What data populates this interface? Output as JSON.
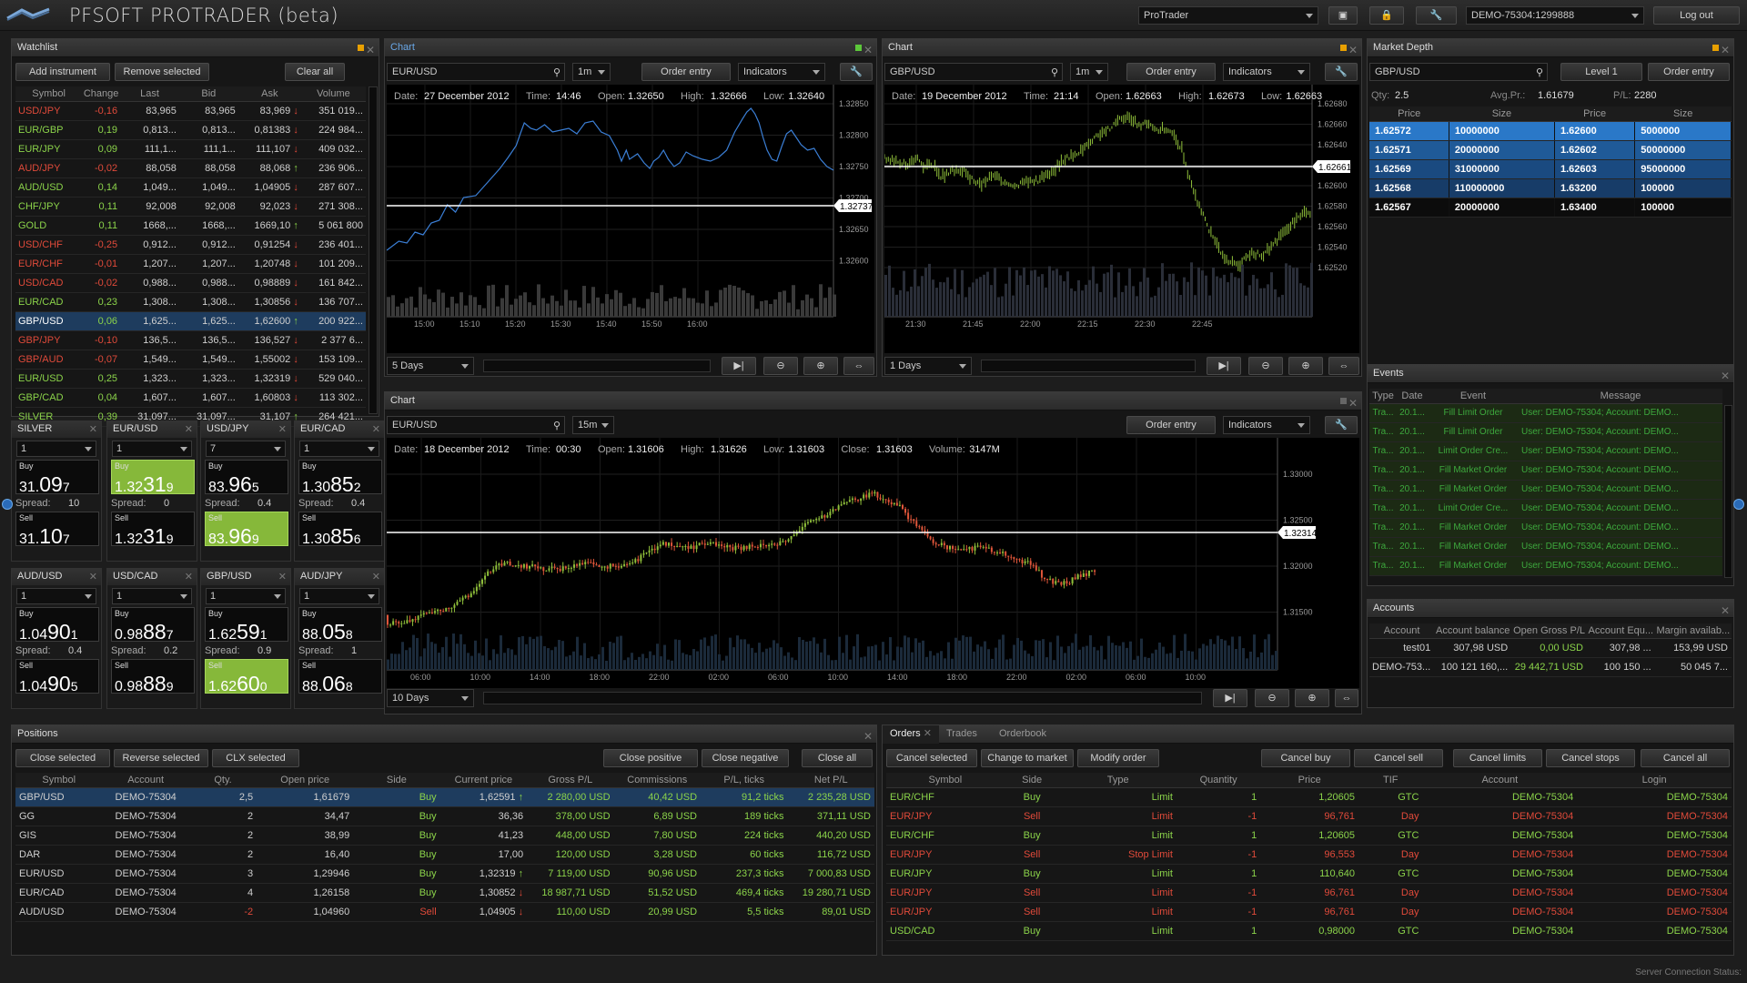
{
  "app": {
    "title": "PFSOFT PROTRADER (beta)",
    "workspace": "ProTrader",
    "account": "DEMO-75304:1299888",
    "logout": "Log out",
    "status": "Server Connection Status:"
  },
  "watchlist": {
    "title": "Watchlist",
    "add": "Add instrument",
    "remove": "Remove selected",
    "clear": "Clear all",
    "cols": [
      "Symbol",
      "Change",
      "Last",
      "Bid",
      "Ask",
      "Volume"
    ],
    "rows": [
      [
        "USD/JPY",
        "-0,16",
        "83,965",
        "83,965",
        "83,969",
        "351 019...",
        "red",
        "dn"
      ],
      [
        "EUR/GBP",
        "0,19",
        "0,813...",
        "0,813...",
        "0,81383",
        "224 984...",
        "grn",
        "dn"
      ],
      [
        "EUR/JPY",
        "0,09",
        "111,1...",
        "111,1...",
        "111,107",
        "409 032...",
        "grn",
        "dn"
      ],
      [
        "AUD/JPY",
        "-0,02",
        "88,058",
        "88,058",
        "88,068",
        "236 906...",
        "red",
        "up"
      ],
      [
        "AUD/USD",
        "0,14",
        "1,049...",
        "1,049...",
        "1,04905",
        "287 607...",
        "grn",
        "dn"
      ],
      [
        "CHF/JPY",
        "0,11",
        "92,008",
        "92,008",
        "92,023",
        "271 308...",
        "grn",
        "dn"
      ],
      [
        "GOLD",
        "0,11",
        "1668,...",
        "1668,...",
        "1669,10",
        "5 061 800",
        "grn",
        "up"
      ],
      [
        "USD/CHF",
        "-0,25",
        "0,912...",
        "0,912...",
        "0,91254",
        "236 401...",
        "red",
        "dn"
      ],
      [
        "EUR/CHF",
        "-0,01",
        "1,207...",
        "1,207...",
        "1,20748",
        "101 209...",
        "red",
        "dn"
      ],
      [
        "USD/CAD",
        "-0,02",
        "0,988...",
        "0,988...",
        "0,98889",
        "161 842...",
        "red",
        "dn"
      ],
      [
        "EUR/CAD",
        "0,23",
        "1,308...",
        "1,308...",
        "1,30856",
        "136 707...",
        "grn",
        "dn"
      ],
      [
        "GBP/USD",
        "0,06",
        "1,625...",
        "1,625...",
        "1,62600",
        "200 922...",
        "grn",
        "up"
      ],
      [
        "GBP/JPY",
        "-0,10",
        "136,5...",
        "136,5...",
        "136,527",
        "2 377 6...",
        "red",
        "dn"
      ],
      [
        "GBP/AUD",
        "-0,07",
        "1,549...",
        "1,549...",
        "1,55002",
        "153 109...",
        "red",
        "dn"
      ],
      [
        "EUR/USD",
        "0,25",
        "1,323...",
        "1,323...",
        "1,32319",
        "529 040...",
        "grn",
        "dn"
      ],
      [
        "GBP/CAD",
        "0,04",
        "1,607...",
        "1,607...",
        "1,60803",
        "113 302...",
        "grn",
        "dn"
      ],
      [
        "SILVER",
        "0,39",
        "31,097...",
        "31,097...",
        "31,107",
        "264 421...",
        "grn",
        "up"
      ]
    ]
  },
  "tiles": [
    {
      "sym": "SILVER",
      "qty": "1",
      "buy": [
        "31.",
        "09",
        "7"
      ],
      "spread": "10",
      "sell": [
        "31.",
        "10",
        "7"
      ],
      "hb": false,
      "hs": false
    },
    {
      "sym": "EUR/USD",
      "qty": "1",
      "buy": [
        "1.32",
        "31",
        "9"
      ],
      "spread": "0",
      "sell": [
        "1.32",
        "31",
        "9"
      ],
      "hb": true,
      "hs": false
    },
    {
      "sym": "USD/JPY",
      "qty": "7",
      "buy": [
        "83.",
        "96",
        "5"
      ],
      "spread": "0.4",
      "sell": [
        "83.",
        "96",
        "9"
      ],
      "hb": false,
      "hs": true
    },
    {
      "sym": "EUR/CAD",
      "qty": "1",
      "buy": [
        "1.30",
        "85",
        "2"
      ],
      "spread": "0.4",
      "sell": [
        "1.30",
        "85",
        "6"
      ],
      "hb": false,
      "hs": false
    },
    {
      "sym": "AUD/USD",
      "qty": "1",
      "buy": [
        "1.04",
        "90",
        "1"
      ],
      "spread": "0.4",
      "sell": [
        "1.04",
        "90",
        "5"
      ],
      "hb": false,
      "hs": false
    },
    {
      "sym": "USD/CAD",
      "qty": "1",
      "buy": [
        "0.98",
        "88",
        "7"
      ],
      "spread": "0.2",
      "sell": [
        "0.98",
        "88",
        "9"
      ],
      "hb": false,
      "hs": false
    },
    {
      "sym": "GBP/USD",
      "qty": "1",
      "buy": [
        "1.62",
        "59",
        "1"
      ],
      "spread": "0.9",
      "sell": [
        "1.62",
        "60",
        "0"
      ],
      "hb": false,
      "hs": true
    },
    {
      "sym": "AUD/JPY",
      "qty": "1",
      "buy": [
        "88.",
        "05",
        "8"
      ],
      "spread": "1",
      "sell": [
        "88.",
        "06",
        "8"
      ],
      "hb": false,
      "hs": false
    }
  ],
  "tileLabels": {
    "buy": "Buy",
    "sell": "Sell",
    "spread": "Spread:"
  },
  "chart1": {
    "title": "Chart",
    "symbol": "EUR/USD",
    "tf": "1m",
    "order": "Order entry",
    "ind": "Indicators",
    "range": "5 Days",
    "info": {
      "date": "27 December 2012",
      "time": "14:46",
      "open": "1.32650",
      "high": "1.32666",
      "low": "1.32640"
    },
    "yticks": [
      "1.32850",
      "1.32800",
      "1.32750",
      "1.32700",
      "1.32650",
      "1.32600"
    ],
    "xticks": [
      "15:00",
      "15:10",
      "15:20",
      "15:30",
      "15:40",
      "15:50",
      "16:00"
    ],
    "last": "1.32737"
  },
  "chart2": {
    "title": "Chart",
    "symbol": "GBP/USD",
    "tf": "1m",
    "order": "Order entry",
    "ind": "Indicators",
    "range": "1 Days",
    "info": {
      "date": "19 December 2012",
      "time": "21:14",
      "open": "1.62663",
      "high": "1.62673",
      "low": "1.62663"
    },
    "yticks": [
      "1.62680",
      "1.62660",
      "1.62640",
      "1.62620",
      "1.62600",
      "1.62580",
      "1.62560",
      "1.62540",
      "1.62520"
    ],
    "xticks": [
      "21:30",
      "21:45",
      "22:00",
      "22:15",
      "22:30",
      "22:45"
    ],
    "last": "1.62661"
  },
  "chart3": {
    "title": "Chart",
    "symbol": "EUR/USD",
    "tf": "15m",
    "order": "Order entry",
    "ind": "Indicators",
    "range": "10 Days",
    "info": {
      "date": "18 December 2012",
      "time": "00:30",
      "open": "1.31606",
      "high": "1.31626",
      "low": "1.31603",
      "close": "1.31603",
      "volume": "3147M"
    },
    "yticks": [
      "1.33000",
      "1.32500",
      "1.32000",
      "1.31500"
    ],
    "xticks": [
      "06:00",
      "10:00",
      "14:00",
      "18:00",
      "22:00",
      "02:00",
      "06:00",
      "10:00",
      "14:00",
      "18:00",
      "22:00",
      "02:00",
      "06:00",
      "10:00"
    ],
    "last": "1.32314"
  },
  "infoLabels": {
    "date": "Date:",
    "time": "Time:",
    "open": "Open:",
    "high": "High:",
    "low": "Low:",
    "close": "Close:",
    "volume": "Volume:"
  },
  "depth": {
    "title": "Market Depth",
    "symbol": "GBP/USD",
    "level": "Level 1",
    "order": "Order entry",
    "qtyL": "Qty:",
    "qty": "2.5",
    "avgL": "Avg.Pr.:",
    "avg": "1.61679",
    "plL": "P/L:",
    "pl": "2280",
    "cols": [
      "Price",
      "Size",
      "Price",
      "Size"
    ],
    "rows": [
      [
        "1.62572",
        "10000000",
        "1.62600",
        "5000000"
      ],
      [
        "1.62571",
        "20000000",
        "1.62602",
        "50000000"
      ],
      [
        "1.62569",
        "31000000",
        "1.62603",
        "95000000"
      ],
      [
        "1.62568",
        "110000000",
        "1.63200",
        "100000"
      ],
      [
        "1.62567",
        "20000000",
        "1.63400",
        "100000"
      ]
    ]
  },
  "events": {
    "title": "Events",
    "cols": [
      "Type",
      "Date",
      "Event",
      "Message"
    ],
    "rows": [
      [
        "Tra...",
        "20.1...",
        "Fill Limit Order",
        "User: DEMO-75304; Account: DEMO..."
      ],
      [
        "Tra...",
        "20.1...",
        "Fill Limit Order",
        "User: DEMO-75304; Account: DEMO..."
      ],
      [
        "Tra...",
        "20.1...",
        "Limit Order Cre...",
        "User: DEMO-75304; Account: DEMO..."
      ],
      [
        "Tra...",
        "20.1...",
        "Fill Market Order",
        "User: DEMO-75304; Account: DEMO..."
      ],
      [
        "Tra...",
        "20.1...",
        "Fill Market Order",
        "User: DEMO-75304; Account: DEMO..."
      ],
      [
        "Tra...",
        "20.1...",
        "Limit Order Cre...",
        "User: DEMO-75304; Account: DEMO..."
      ],
      [
        "Tra...",
        "20.1...",
        "Fill Market Order",
        "User: DEMO-75304; Account: DEMO..."
      ],
      [
        "Tra...",
        "20.1...",
        "Fill Market Order",
        "User: DEMO-75304; Account: DEMO..."
      ],
      [
        "Tra...",
        "20.1...",
        "Fill Market Order",
        "User: DEMO-75304; Account: DEMO..."
      ]
    ]
  },
  "accounts": {
    "title": "Accounts",
    "cols": [
      "Account",
      "Account balance",
      "Open Gross P/L",
      "Account Equ...",
      "Margin availab..."
    ],
    "rows": [
      [
        "test01",
        "307,98 USD",
        "0,00 USD",
        "307,98 ...",
        "153,99 USD"
      ],
      [
        "DEMO-753...",
        "100 121 160,...",
        "29 442,71 USD",
        "100 150 ...",
        "50 045 7..."
      ]
    ]
  },
  "positions": {
    "title": "Positions",
    "b1": "Close selected",
    "b2": "Reverse selected",
    "b3": "CLX selected",
    "b4": "Close positive",
    "b5": "Close negative",
    "b6": "Close all",
    "cols": [
      "Symbol",
      "Account",
      "Qty.",
      "Open price",
      "Side",
      "Current price",
      "Gross P/L",
      "Commissions",
      "P/L, ticks",
      "Net P/L"
    ],
    "rows": [
      [
        "GBP/USD",
        "DEMO-75304",
        "2,5",
        "1,61679",
        "Buy",
        "1,62591",
        "2 280,00 USD",
        "40,42 USD",
        "91,2 ticks",
        "2 235,28 USD",
        "up"
      ],
      [
        "GG",
        "DEMO-75304",
        "2",
        "34,47",
        "Buy",
        "36,36",
        "378,00 USD",
        "6,89 USD",
        "189 ticks",
        "371,11 USD",
        ""
      ],
      [
        "GIS",
        "DEMO-75304",
        "2",
        "38,99",
        "Buy",
        "41,23",
        "448,00 USD",
        "7,80 USD",
        "224 ticks",
        "440,20 USD",
        ""
      ],
      [
        "DAR",
        "DEMO-75304",
        "2",
        "16,40",
        "Buy",
        "17,00",
        "120,00 USD",
        "3,28 USD",
        "60 ticks",
        "116,72 USD",
        ""
      ],
      [
        "EUR/USD",
        "DEMO-75304",
        "3",
        "1,29946",
        "Buy",
        "1,32319",
        "7 119,00 USD",
        "90,96 USD",
        "237,3 ticks",
        "7 000,83 USD",
        "up"
      ],
      [
        "EUR/CAD",
        "DEMO-75304",
        "4",
        "1,26158",
        "Buy",
        "1,30852",
        "18 987,71 USD",
        "51,52 USD",
        "469,4 ticks",
        "19 280,71 USD",
        "dn"
      ],
      [
        "AUD/USD",
        "DEMO-75304",
        "-2",
        "1,04960",
        "Sell",
        "1,04905",
        "110,00 USD",
        "20,99 USD",
        "5,5 ticks",
        "89,01 USD",
        "dn"
      ]
    ]
  },
  "orders": {
    "tabs": [
      "Orders",
      "Trades",
      "Orderbook"
    ],
    "b1": "Cancel selected",
    "b2": "Change to market",
    "b3": "Modify order",
    "b4": "Cancel buy",
    "b5": "Cancel sell",
    "b6": "Cancel limits",
    "b7": "Cancel stops",
    "b8": "Cancel all",
    "cols": [
      "Symbol",
      "Side",
      "Type",
      "Quantity",
      "Price",
      "TIF",
      "Account",
      "Login"
    ],
    "rows": [
      [
        "EUR/CHF",
        "Buy",
        "Limit",
        "1",
        "1,20605",
        "GTC",
        "DEMO-75304",
        "DEMO-75304"
      ],
      [
        "EUR/JPY",
        "Sell",
        "Limit",
        "-1",
        "96,761",
        "Day",
        "DEMO-75304",
        "DEMO-75304"
      ],
      [
        "EUR/CHF",
        "Buy",
        "Limit",
        "1",
        "1,20605",
        "GTC",
        "DEMO-75304",
        "DEMO-75304"
      ],
      [
        "EUR/JPY",
        "Sell",
        "Stop Limit",
        "-1",
        "96,553",
        "Day",
        "DEMO-75304",
        "DEMO-75304"
      ],
      [
        "EUR/JPY",
        "Buy",
        "Limit",
        "1",
        "110,640",
        "GTC",
        "DEMO-75304",
        "DEMO-75304"
      ],
      [
        "EUR/JPY",
        "Sell",
        "Limit",
        "-1",
        "96,761",
        "Day",
        "DEMO-75304",
        "DEMO-75304"
      ],
      [
        "EUR/JPY",
        "Sell",
        "Limit",
        "-1",
        "96,761",
        "Day",
        "DEMO-75304",
        "DEMO-75304"
      ],
      [
        "USD/CAD",
        "Buy",
        "Limit",
        "1",
        "0,98000",
        "GTC",
        "DEMO-75304",
        "DEMO-75304"
      ]
    ]
  }
}
